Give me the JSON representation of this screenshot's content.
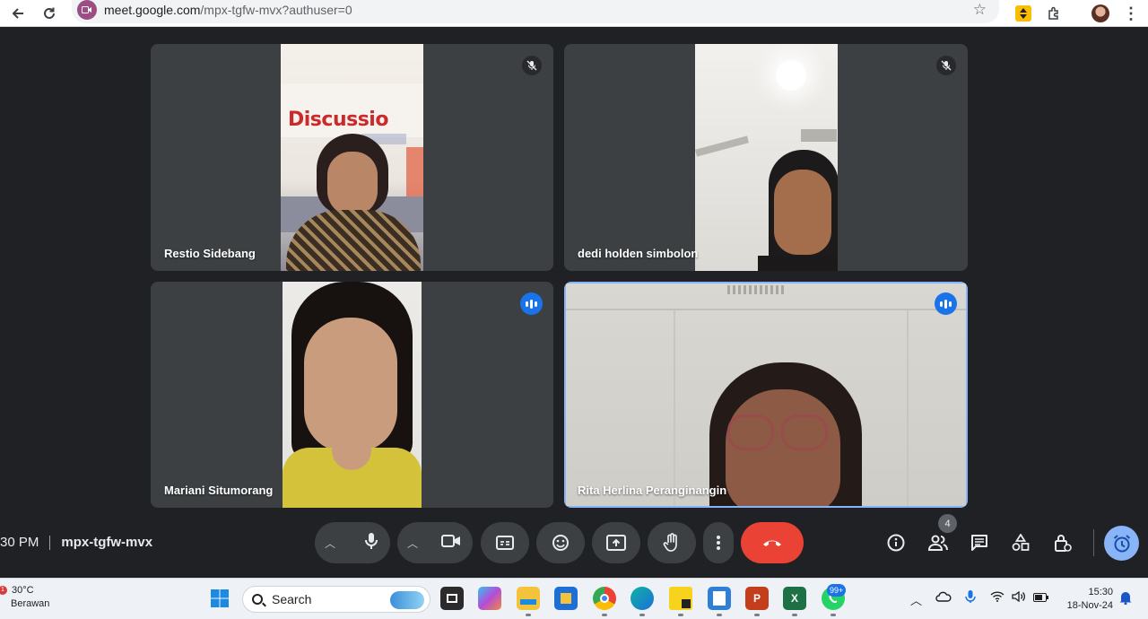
{
  "browser": {
    "url_host": "meet.google.com",
    "url_path": "/mpx-tgfw-mvx?authuser=0",
    "icons": [
      "back-arrow-icon",
      "reload-icon",
      "meet-site-icon",
      "bookmark-star-icon",
      "extension-icon",
      "extensions-puzzle-icon",
      "profile-avatar",
      "kebab-menu-icon"
    ]
  },
  "participants": [
    {
      "name": "Restio Sidebang",
      "banner_text": "Discussio",
      "status": "muted"
    },
    {
      "name": "dedi holden simbolon",
      "status": "muted"
    },
    {
      "name": "Mariani Situmorang",
      "status": "speaking"
    },
    {
      "name": "Rita Herlina Peranginangin",
      "status": "speaking",
      "pinned_highlight": true
    }
  ],
  "meeting": {
    "time": "30 PM",
    "code": "mpx-tgfw-mvx",
    "people_count": "4"
  },
  "controls": {
    "items": [
      "mic-options",
      "mic",
      "camera-options",
      "camera",
      "captions",
      "emoji-reactions",
      "present-screen",
      "raise-hand",
      "more-options",
      "leave-call"
    ],
    "side": [
      "meeting-details",
      "people",
      "chat",
      "activities",
      "host-controls",
      "timer"
    ]
  },
  "taskbar": {
    "weather_badge": "1",
    "temperature": "30°C",
    "condition": "Berawan",
    "search_label": "Search",
    "whatsapp_badge": "99+",
    "time": "15:30",
    "date": "18-Nov-24"
  },
  "colors": {
    "stage_bg": "#202124",
    "tile_bg": "#3c4043",
    "end_call": "#ea4335",
    "speaking_blue": "#1a73e8",
    "active_outline": "#8ab4f8"
  }
}
